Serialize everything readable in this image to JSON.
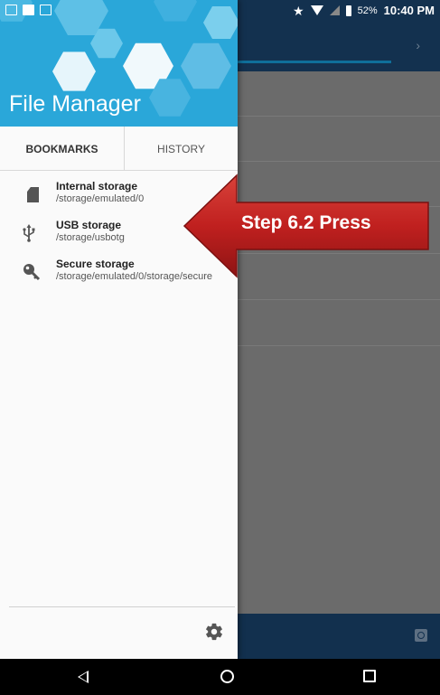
{
  "status_bar": {
    "battery": "52%",
    "time": "10:40 PM"
  },
  "drawer": {
    "title": "File Manager",
    "tabs": [
      {
        "label": "BOOKMARKS",
        "active": true
      },
      {
        "label": "HISTORY",
        "active": false
      }
    ],
    "storage_items": [
      {
        "name": "Internal storage",
        "path": "/storage/emulated/0",
        "icon": "sd-card-icon"
      },
      {
        "name": "USB storage",
        "path": "/storage/usbotg",
        "icon": "usb-icon"
      },
      {
        "name": "Secure storage",
        "path": "/storage/emulated/0/storage/secure",
        "icon": "key-icon"
      }
    ],
    "settings_icon": "gear-icon"
  },
  "callout": {
    "label": "Step 6.2 Press",
    "color": "#c0201f"
  },
  "colors": {
    "drawer_header": "#2aa7d9",
    "app_bar": "#13314f",
    "dim_overlay": "#6b6b6b"
  },
  "nav_bar": {
    "icons": [
      "back-icon",
      "home-icon",
      "recents-icon"
    ]
  }
}
